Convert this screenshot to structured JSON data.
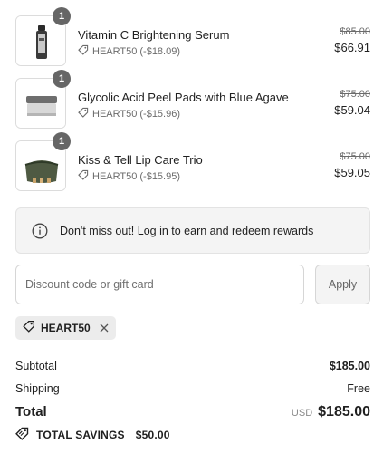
{
  "items": [
    {
      "quantity": "1",
      "name": "Vitamin C Brightening Serum",
      "discount": "HEART50 (-$18.09)",
      "original_price": "$85.00",
      "price": "$66.91",
      "image": "serum-bottle"
    },
    {
      "quantity": "1",
      "name": "Glycolic Acid Peel Pads with Blue Agave",
      "discount": "HEART50 (-$15.96)",
      "original_price": "$75.00",
      "price": "$59.04",
      "image": "peel-pad-jar"
    },
    {
      "quantity": "1",
      "name": "Kiss & Tell Lip Care Trio",
      "discount": "HEART50 (-$15.95)",
      "original_price": "$75.00",
      "price": "$59.05",
      "image": "lip-care-pouch"
    }
  ],
  "notice": {
    "icon": "info-icon",
    "prefix": "Don't miss out! ",
    "link": "Log in",
    "suffix": " to earn and redeem rewards"
  },
  "discount_form": {
    "placeholder": "Discount code or gift card",
    "value": "",
    "apply_label": "Apply"
  },
  "applied_code": {
    "label": "HEART50",
    "icon": "tag-icon",
    "remove_icon": "close-icon"
  },
  "summary": {
    "subtotal_label": "Subtotal",
    "subtotal_value": "$185.00",
    "shipping_label": "Shipping",
    "shipping_value": "Free",
    "total_label": "Total",
    "currency": "USD",
    "total_value": "$185.00",
    "savings_label": "TOTAL SAVINGS",
    "savings_value": "$50.00"
  },
  "colors": {
    "badge": "#666666",
    "notice_bg": "#f4f4f4",
    "chip_bg": "#ececec",
    "text": "#1f1f1f",
    "muted": "#6b6b6b"
  }
}
